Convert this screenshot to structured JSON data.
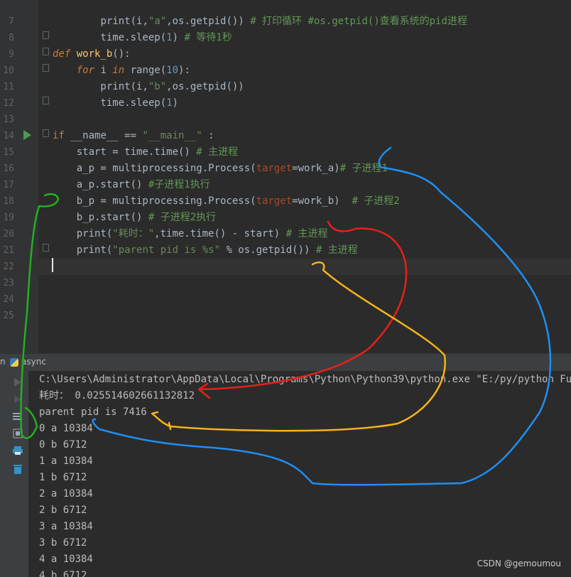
{
  "editor": {
    "lines": [
      {
        "n": "7",
        "code": [
          [
            "        ",
            ""
          ],
          [
            "print",
            "tok-dunder"
          ],
          [
            "(i,",
            ""
          ],
          [
            "\"a\"",
            "tok-str"
          ],
          [
            ",os.getpid()) ",
            ""
          ],
          [
            "# 打印循环 #os.getpid()查看系统的pid进程",
            "tok-cm"
          ]
        ]
      },
      {
        "n": "8",
        "code": [
          [
            "        time.sleep(",
            ""
          ],
          [
            "1",
            "tok-num"
          ],
          [
            ") ",
            ""
          ],
          [
            "# 等待1秒",
            "tok-cm"
          ]
        ]
      },
      {
        "n": "9",
        "code": [
          [
            "def ",
            "tok-kwi"
          ],
          [
            "work_b",
            "tok-fn"
          ],
          [
            "():",
            ""
          ]
        ]
      },
      {
        "n": "10",
        "code": [
          [
            "    ",
            ""
          ],
          [
            "for ",
            "tok-kwi"
          ],
          [
            "i ",
            ""
          ],
          [
            "in ",
            "tok-kwi"
          ],
          [
            "range(",
            ""
          ],
          [
            "10",
            "tok-num"
          ],
          [
            "):",
            ""
          ]
        ]
      },
      {
        "n": "11",
        "code": [
          [
            "        print(i,",
            ""
          ],
          [
            "\"b\"",
            "tok-str"
          ],
          [
            ",os.getpid())",
            ""
          ]
        ]
      },
      {
        "n": "12",
        "code": [
          [
            "        time.sleep(",
            ""
          ],
          [
            "1",
            "tok-num"
          ],
          [
            ")",
            ""
          ]
        ]
      },
      {
        "n": "13",
        "code": []
      },
      {
        "n": "14",
        "code": [
          [
            "if ",
            "tok-kw"
          ],
          [
            "__name__ == ",
            ""
          ],
          [
            "\"__main__\"",
            "tok-str"
          ],
          [
            " :",
            ""
          ]
        ]
      },
      {
        "n": "15",
        "code": [
          [
            "    start = time.time() ",
            ""
          ],
          [
            "# 主进程",
            "tok-cm"
          ]
        ]
      },
      {
        "n": "16",
        "code": [
          [
            "    a_p = multiprocessing.Process(",
            ""
          ],
          [
            "target",
            "tok-param"
          ],
          [
            "=work_a)",
            ""
          ],
          [
            "# 子进程1",
            "tok-cm"
          ]
        ]
      },
      {
        "n": "17",
        "code": [
          [
            "    a_p.start() ",
            ""
          ],
          [
            "#子进程1执行",
            "tok-cm"
          ]
        ]
      },
      {
        "n": "18",
        "code": [
          [
            "    b_p = multiprocessing.Process(",
            ""
          ],
          [
            "target",
            "tok-param"
          ],
          [
            "=work_b)  ",
            ""
          ],
          [
            "# 子进程2",
            "tok-cm"
          ]
        ]
      },
      {
        "n": "19",
        "code": [
          [
            "    b_p.start() ",
            ""
          ],
          [
            "# 子进程2执行",
            "tok-cm"
          ]
        ]
      },
      {
        "n": "20",
        "code": [
          [
            "    print(",
            ""
          ],
          [
            "\"耗时：\"",
            "tok-str"
          ],
          [
            ",time.time() - start) ",
            ""
          ],
          [
            "# 主进程",
            "tok-cm"
          ]
        ]
      },
      {
        "n": "21",
        "code": [
          [
            "    print(",
            ""
          ],
          [
            "\"parent pid is %s\"",
            "tok-str"
          ],
          [
            " % os.getpid()) ",
            ""
          ],
          [
            "# 主进程",
            "tok-cm"
          ]
        ]
      },
      {
        "n": "22",
        "code": []
      },
      {
        "n": "23",
        "code": []
      },
      {
        "n": "24",
        "code": []
      },
      {
        "n": "25",
        "code": []
      }
    ]
  },
  "run_panel": {
    "tab_partial": "n",
    "tab_label": "async"
  },
  "console": {
    "lines": [
      "C:\\Users\\Administrator\\AppData\\Local\\Programs\\Python\\Python39\\python.exe \"E:/py/python Full st",
      "耗时： 0.025514602661132812",
      "parent pid is 7416",
      "0 a 10384",
      "0 b 6712",
      "1 a 10384",
      "1 b 6712",
      "2 a 10384",
      "2 b 6712",
      "3 a 10384",
      "3 b 6712",
      "4 a 10384",
      "4 b 6712"
    ]
  },
  "watermark": "CSDN @gemoumou",
  "annotation_colors": {
    "green": "#22b022",
    "red": "#e8201a",
    "orange": "#f5b21a",
    "blue": "#1f8ef0"
  }
}
